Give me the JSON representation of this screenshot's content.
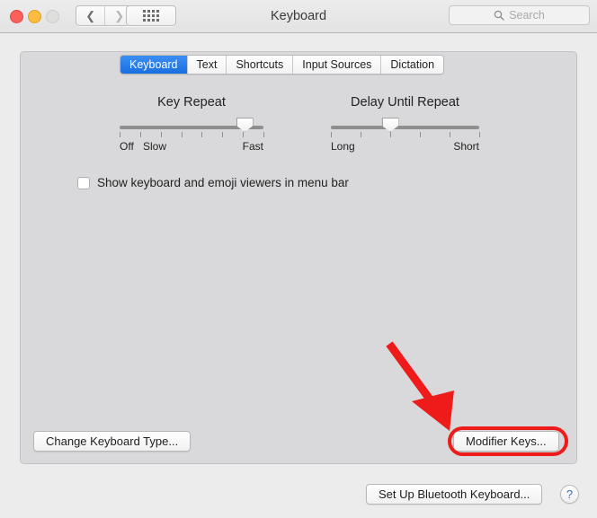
{
  "window": {
    "title": "Keyboard",
    "traffic_lights": [
      "close",
      "minimize",
      "zoom"
    ],
    "nav": {
      "back_icon": "chevron-left-icon",
      "forward_icon": "chevron-right-icon"
    },
    "show_all_icon": "grid-dots-icon",
    "search": {
      "placeholder": "Search",
      "value": "",
      "icon": "search-icon"
    }
  },
  "tabs": [
    {
      "label": "Keyboard",
      "active": true
    },
    {
      "label": "Text",
      "active": false
    },
    {
      "label": "Shortcuts",
      "active": false
    },
    {
      "label": "Input Sources",
      "active": false
    },
    {
      "label": "Dictation",
      "active": false
    }
  ],
  "sliders": {
    "key_repeat": {
      "title": "Key Repeat",
      "left_labels": [
        "Off",
        "Slow"
      ],
      "right_label": "Fast",
      "ticks": 8,
      "value_index": 7,
      "value_percent": 87
    },
    "delay_until_repeat": {
      "title": "Delay Until Repeat",
      "left_label": "Long",
      "right_label": "Short",
      "ticks": 6,
      "value_index": 3,
      "value_percent": 40
    }
  },
  "checkbox": {
    "label": "Show keyboard and emoji viewers in menu bar",
    "checked": false
  },
  "buttons": {
    "change_keyboard_type": "Change Keyboard Type...",
    "modifier_keys": "Modifier Keys...",
    "setup_bluetooth_keyboard": "Set Up Bluetooth Keyboard...",
    "help": "?"
  },
  "annotations": {
    "highlight_color": "#ef1a1a",
    "arrow": "red-arrow-pointing-to-modifier-keys",
    "ring": "red-ring-around-modifier-keys"
  },
  "colors": {
    "accent": "#1a6fe0",
    "window_bg": "#ececec",
    "panel_bg": "#d9d9db",
    "annotation_red": "#ef1a1a"
  }
}
